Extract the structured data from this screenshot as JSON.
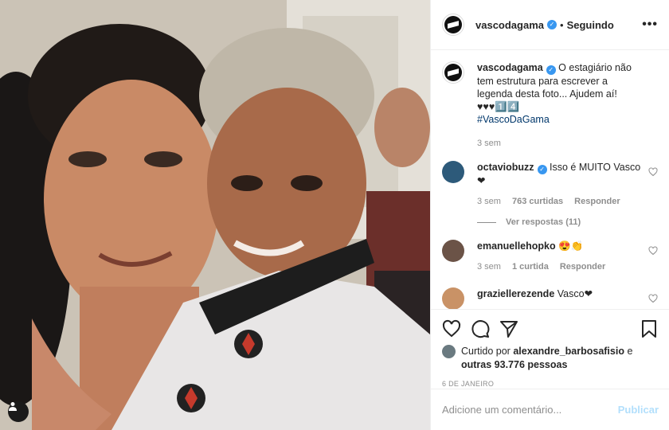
{
  "post": {
    "username": "vascodagama",
    "separator": "•",
    "follow_state": "Seguindo",
    "more_label": "•••"
  },
  "caption": {
    "username": "vascodagama",
    "text": "O estagiário não tem estrutura para escrever a legenda desta foto... Ajudem aí! ♥♥♥1️⃣4️⃣",
    "hashtag": "#VascoDaGama",
    "time": "3 sem"
  },
  "comments": [
    {
      "username": "octaviobuzz",
      "verified": true,
      "text": "Isso é MUITO Vasco❤",
      "time": "3 sem",
      "likes": "763 curtidas",
      "reply_label": "Responder",
      "view_replies": "Ver respostas (11)"
    },
    {
      "username": "emanuellehopko",
      "verified": false,
      "text": "😍👏",
      "time": "3 sem",
      "likes": "1 curtida",
      "reply_label": "Responder"
    },
    {
      "username": "graziellerezende",
      "verified": false,
      "text": "Vasco❤",
      "time": "",
      "likes": "",
      "reply_label": ""
    }
  ],
  "likes": {
    "prefix": "Curtido por",
    "user": "alexandre_barbosafisio",
    "middle": "e",
    "others": "outras 93.776 pessoas"
  },
  "date": "6 DE JANEIRO",
  "comment_box": {
    "placeholder": "Adicione um comentário...",
    "publish_label": "Publicar"
  },
  "icons": {
    "verified": "verified-badge-icon",
    "like": "heart-icon",
    "comment": "comment-icon",
    "share": "share-icon",
    "save": "bookmark-icon",
    "user_tags": "user-tag-icon"
  },
  "colors": {
    "verified": "#3897f0",
    "hashtag": "#00376b",
    "muted": "#8e8e8e",
    "publish_disabled": "#b2dffc"
  }
}
